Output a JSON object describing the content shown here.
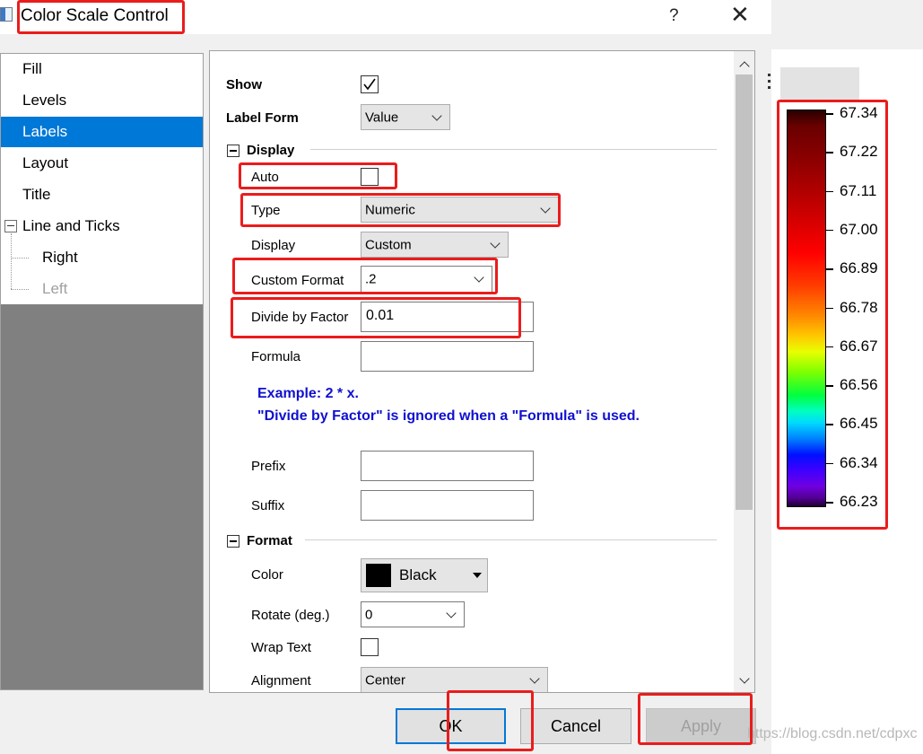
{
  "window": {
    "title": "Color Scale Control",
    "help": "?",
    "close": "✕"
  },
  "tree": {
    "items": [
      {
        "label": "Fill"
      },
      {
        "label": "Levels"
      },
      {
        "label": "Labels"
      },
      {
        "label": "Layout"
      },
      {
        "label": "Title"
      },
      {
        "label": "Line and Ticks"
      },
      {
        "label": "Right"
      },
      {
        "label": "Left"
      }
    ],
    "selected": "Labels"
  },
  "form": {
    "show_label": "Show",
    "show_checked": true,
    "label_form_label": "Label Form",
    "label_form_value": "Value",
    "display_group": "Display",
    "auto_label": "Auto",
    "auto_checked": false,
    "type_label": "Type",
    "type_value": "Numeric",
    "display_label": "Display",
    "display_value": "Custom",
    "custom_format_label": "Custom Format",
    "custom_format_value": ".2",
    "divide_label": "Divide by Factor",
    "divide_value": "0.01",
    "formula_label": "Formula",
    "formula_value": "",
    "note_line1": "Example: 2 * x.",
    "note_line2": "\"Divide by Factor\" is ignored when a \"Formula\" is used.",
    "prefix_label": "Prefix",
    "prefix_value": "",
    "suffix_label": "Suffix",
    "suffix_value": "",
    "format_group": "Format",
    "color_label": "Color",
    "color_value": "Black",
    "color_swatch": "#000000",
    "rotate_label": "Rotate (deg.)",
    "rotate_value": "0",
    "wrap_label": "Wrap Text",
    "wrap_checked": false,
    "alignment_label": "Alignment",
    "alignment_value": "Center"
  },
  "buttons": {
    "ok": "OK",
    "cancel": "Cancel",
    "apply": "Apply"
  },
  "colorbar": {
    "ticks": [
      "67.34",
      "67.22",
      "67.11",
      "67.00",
      "66.89",
      "66.78",
      "66.67",
      "66.56",
      "66.45",
      "66.34",
      "66.23"
    ]
  },
  "watermark": "https://blog.csdn.net/cdpxc",
  "colors": {
    "selection": "#0078d7",
    "annotation": "#ea1c1c",
    "note_text": "#1010d0"
  }
}
